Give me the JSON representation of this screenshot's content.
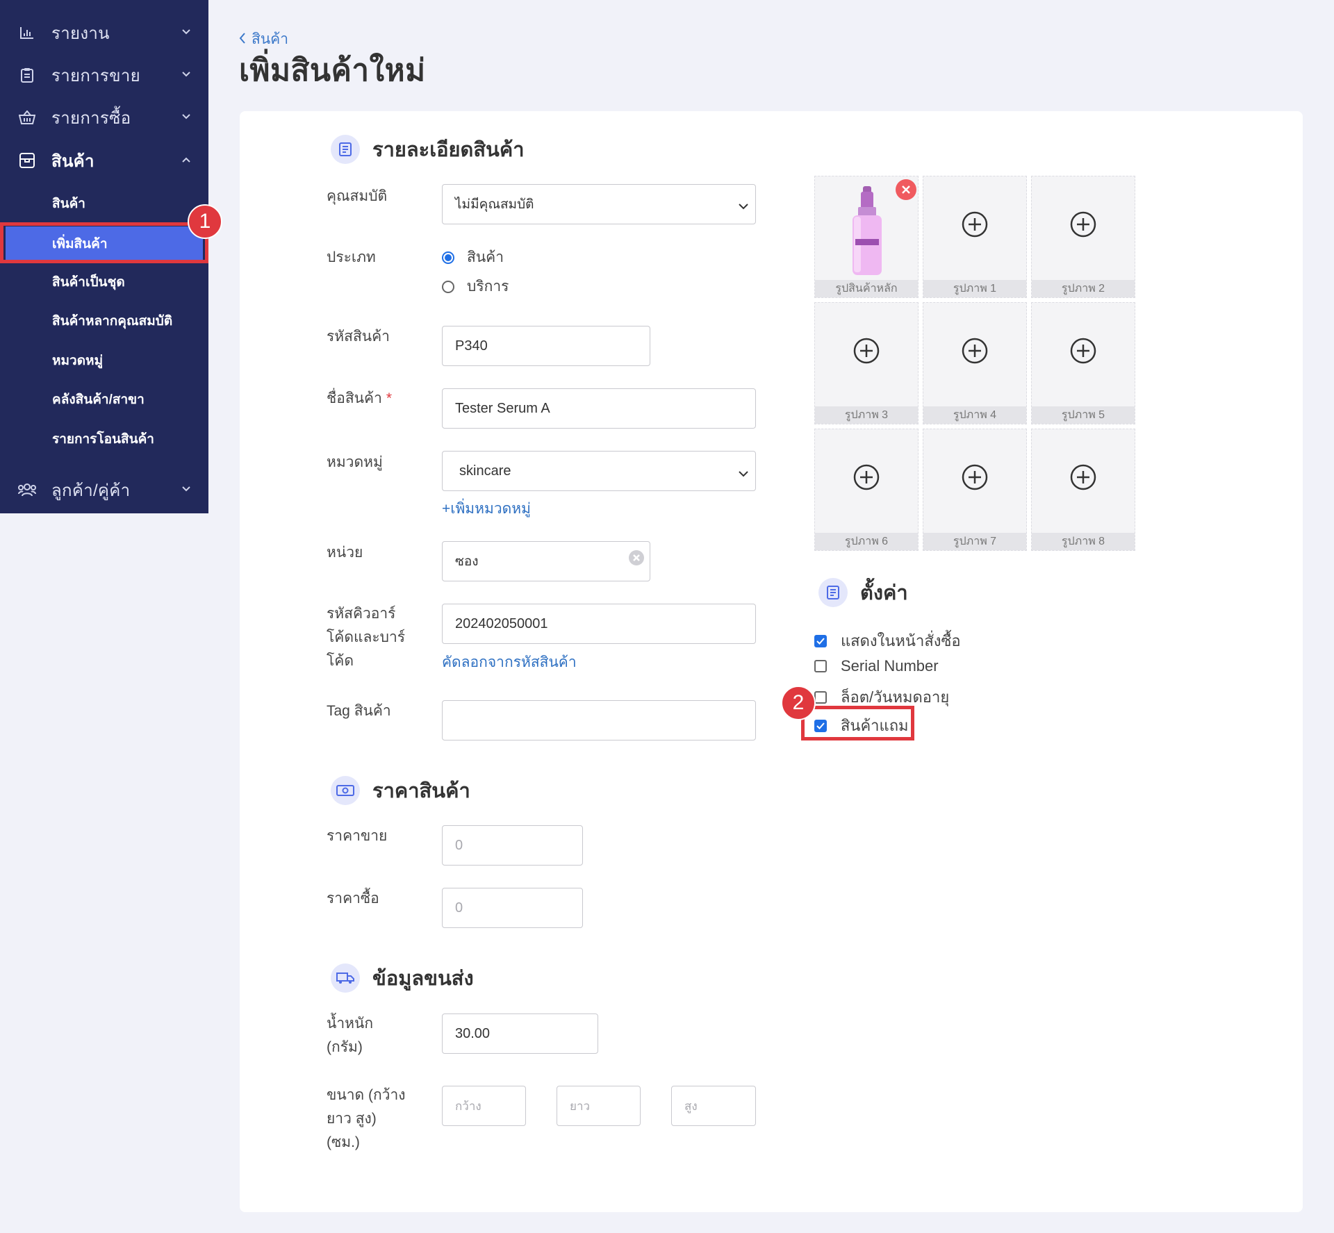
{
  "sidebar": {
    "items": [
      {
        "label": "รายงาน",
        "icon": "bar-chart-icon",
        "expanded": false
      },
      {
        "label": "รายการขาย",
        "icon": "clipboard-icon",
        "expanded": false
      },
      {
        "label": "รายการซื้อ",
        "icon": "basket-icon",
        "expanded": false
      },
      {
        "label": "สินค้า",
        "icon": "box-icon",
        "expanded": true
      },
      {
        "label": "ลูกค้า/คู่ค้า",
        "icon": "users-icon",
        "expanded": false
      }
    ],
    "sub_items": [
      "สินค้า",
      "เพิ่มสินค้า",
      "สินค้าเป็นชุด",
      "สินค้าหลากคุณสมบัติ",
      "หมวดหมู่",
      "คลังสินค้า/สาขา",
      "รายการโอนสินค้า"
    ],
    "selected_sub_item": "เพิ่มสินค้า"
  },
  "annotations": {
    "step1": "1",
    "step2": "2",
    "highlight_color": "#e0383e"
  },
  "breadcrumb": {
    "label": "สินค้า"
  },
  "page_title": "เพิ่มสินค้าใหม่",
  "details": {
    "title": "รายละเอียดสินค้า",
    "attribute": {
      "label": "คุณสมบัติ",
      "value": "ไม่มีคุณสมบัติ"
    },
    "type": {
      "label": "ประเภท",
      "options": [
        "สินค้า",
        "บริการ"
      ],
      "selected": "สินค้า"
    },
    "sku": {
      "label": "รหัสสินค้า",
      "value": "P340"
    },
    "name": {
      "label": "ชื่อสินค้า",
      "required_mark": "*",
      "value": "Tester Serum A"
    },
    "category": {
      "label": "หมวดหมู่",
      "value": "skincare",
      "add_link": "+เพิ่มหมวดหมู่"
    },
    "unit": {
      "label": "หน่วย",
      "value": "ซอง"
    },
    "barcode": {
      "label_lines": [
        "รหัสคิวอาร์",
        "โค้ดและบาร์",
        "โค้ด"
      ],
      "value": "202402050001",
      "copy_link": "คัดลอกจากรหัสสินค้า"
    },
    "tags": {
      "label": "Tag สินค้า",
      "value": ""
    }
  },
  "images": {
    "cells": [
      "รูปสินค้าหลัก",
      "รูปภาพ 1",
      "รูปภาพ 2",
      "รูปภาพ 3",
      "รูปภาพ 4",
      "รูปภาพ 5",
      "รูปภาพ 6",
      "รูปภาพ 7",
      "รูปภาพ 8"
    ]
  },
  "settings": {
    "title": "ตั้งค่า",
    "options": [
      {
        "label": "แสดงในหน้าสั่งซื้อ",
        "checked": true
      },
      {
        "label": "Serial Number",
        "checked": false
      },
      {
        "label": "ล็อต/วันหมดอายุ",
        "checked": false
      },
      {
        "label": "สินค้าแถม",
        "checked": true
      }
    ]
  },
  "price": {
    "title": "ราคาสินค้า",
    "sell": {
      "label": "ราคาขาย",
      "placeholder": "0"
    },
    "buy": {
      "label": "ราคาซื้อ",
      "placeholder": "0"
    }
  },
  "shipping": {
    "title": "ข้อมูลขนส่ง",
    "weight": {
      "label_lines": [
        "น้ำหนัก",
        "(กรัม)"
      ],
      "value": "30.00"
    },
    "size": {
      "label_lines": [
        "ขนาด (กว้าง",
        "ยาว สูง)",
        "(ซม.)"
      ],
      "width_placeholder": "กว้าง",
      "length_placeholder": "ยาว",
      "height_placeholder": "สูง"
    }
  },
  "colors": {
    "sidebar_bg": "#22295b",
    "selected_bg": "#4d6ae6",
    "accent": "#1f6fe6",
    "link": "#2e70c2"
  }
}
